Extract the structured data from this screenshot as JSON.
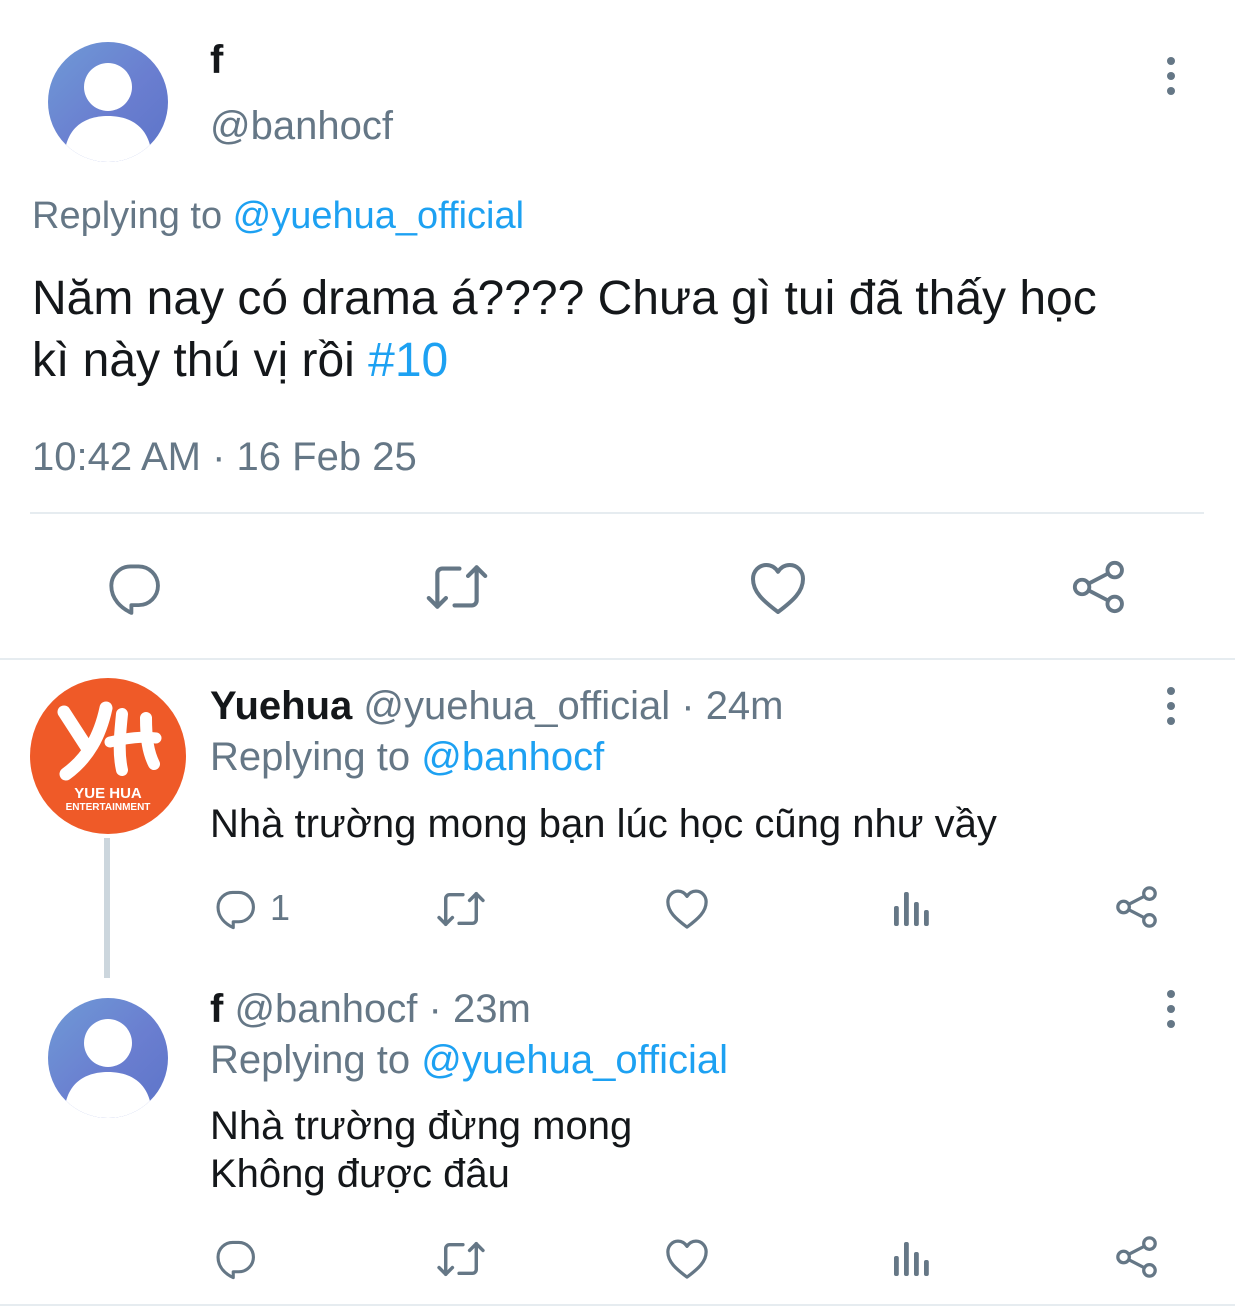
{
  "main_tweet": {
    "display_name": "f",
    "handle": "@banhocf",
    "replying_label": "Replying to ",
    "replying_handle": "@yuehua_official",
    "text_line1": "Năm nay có drama á???? Chưa gì tui đã thấy học",
    "text_line2": "kì này thú vị rồi ",
    "hashtag": "#10",
    "timestamp": "10:42 AM · 16 Feb 25",
    "actions": [
      "reply-icon",
      "retweet-icon",
      "like-icon",
      "share-icon"
    ]
  },
  "replies": [
    {
      "display_name": "Yuehua",
      "handle": "@yuehua_official",
      "time": " · 24m",
      "replying_label": "Replying to ",
      "replying_handle": "@banhocf",
      "text": "Nhà trường mong bạn lúc học cũng như vầy",
      "reply_count": "1",
      "avatar_logo_text": "YUE HUA",
      "avatar_logo_subtext": "ENTERTAINMENT",
      "avatar_color": "#ef5a28"
    },
    {
      "display_name": "f",
      "handle": "@banhocf",
      "time": " · 23m",
      "replying_label": "Replying to ",
      "replying_handle": "@yuehua_official",
      "text_line1": "Nhà trường đừng mong",
      "text_line2": "Không được đâu",
      "reply_count": ""
    }
  ],
  "colors": {
    "accent": "#1da1f2",
    "secondary_text": "#657786",
    "divider": "#e6ecf0"
  }
}
